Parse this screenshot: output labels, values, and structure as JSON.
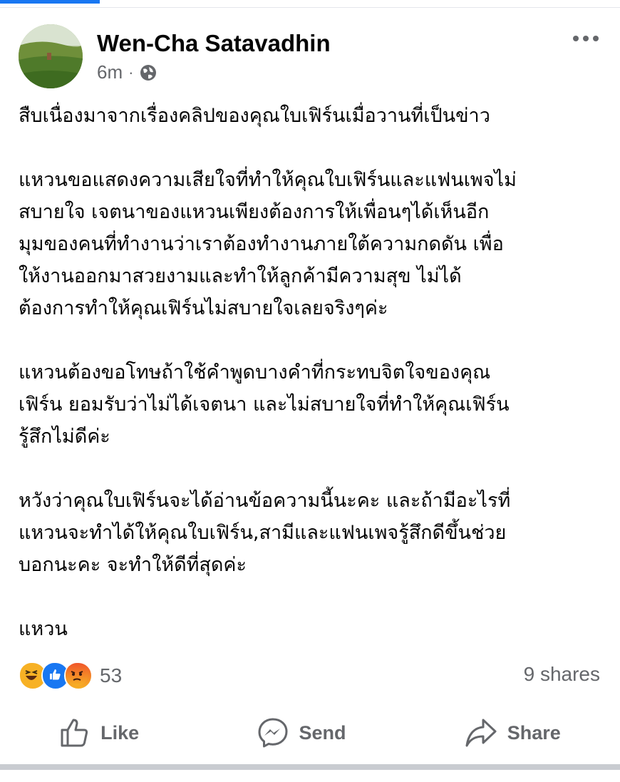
{
  "post": {
    "author": "Wen-Cha Satavadhin",
    "time": "6m",
    "separator": "·",
    "privacy_icon": "globe-icon",
    "paragraphs": [
      "สืบเนื่องมาจากเรื่องคลิปของคุณใบเฟิร์นเมื่อวานที่เป็นข่าว",
      "แหวนขอแสดงความเสียใจที่ทำให้คุณใบเฟิร์นและแฟนเพจไม่\nสบายใจ เจตนาของแหวนเพียงต้องการให้เพื่อนๆได้เห็นอีก\nมุมของคนที่ทำงานว่าเราต้องทำงานภายใต้ความกดดัน เพื่อ\nให้งานออกมาสวยงามและทำให้ลูกค้ามีความสุข ไม่ได้\nต้องการทำให้คุณเฟิร์นไม่สบายใจเลยจริงๆค่ะ",
      "แหวนต้องขอโทษถ้าใช้คำพูดบางคำที่กระทบจิตใจของคุณ\nเฟิร์น ยอมรับว่าไม่ได้เจตนา และไม่สบายใจที่ทำให้คุณเฟิร์น\nรู้สึกไม่ดีค่ะ",
      "หวังว่าคุณใบเฟิร์นจะได้อ่านข้อความนี้นะคะ และถ้ามีอะไรที่\nแหวนจะทำได้ให้คุณใบเฟิร์น,สามีและแฟนเพจรู้สึกดีขึ้นช่วย\nบอกนะคะ จะทำให้ดีที่สุดค่ะ",
      "แหวน"
    ]
  },
  "engagement": {
    "reaction_icons": [
      "haha-icon",
      "like-icon",
      "angry-icon"
    ],
    "reaction_count": "53",
    "shares": "9 shares"
  },
  "actions": {
    "like": "Like",
    "send": "Send",
    "share": "Share"
  },
  "colors": {
    "accent": "#1877f2",
    "text": "#050505",
    "secondary": "#65676b"
  }
}
